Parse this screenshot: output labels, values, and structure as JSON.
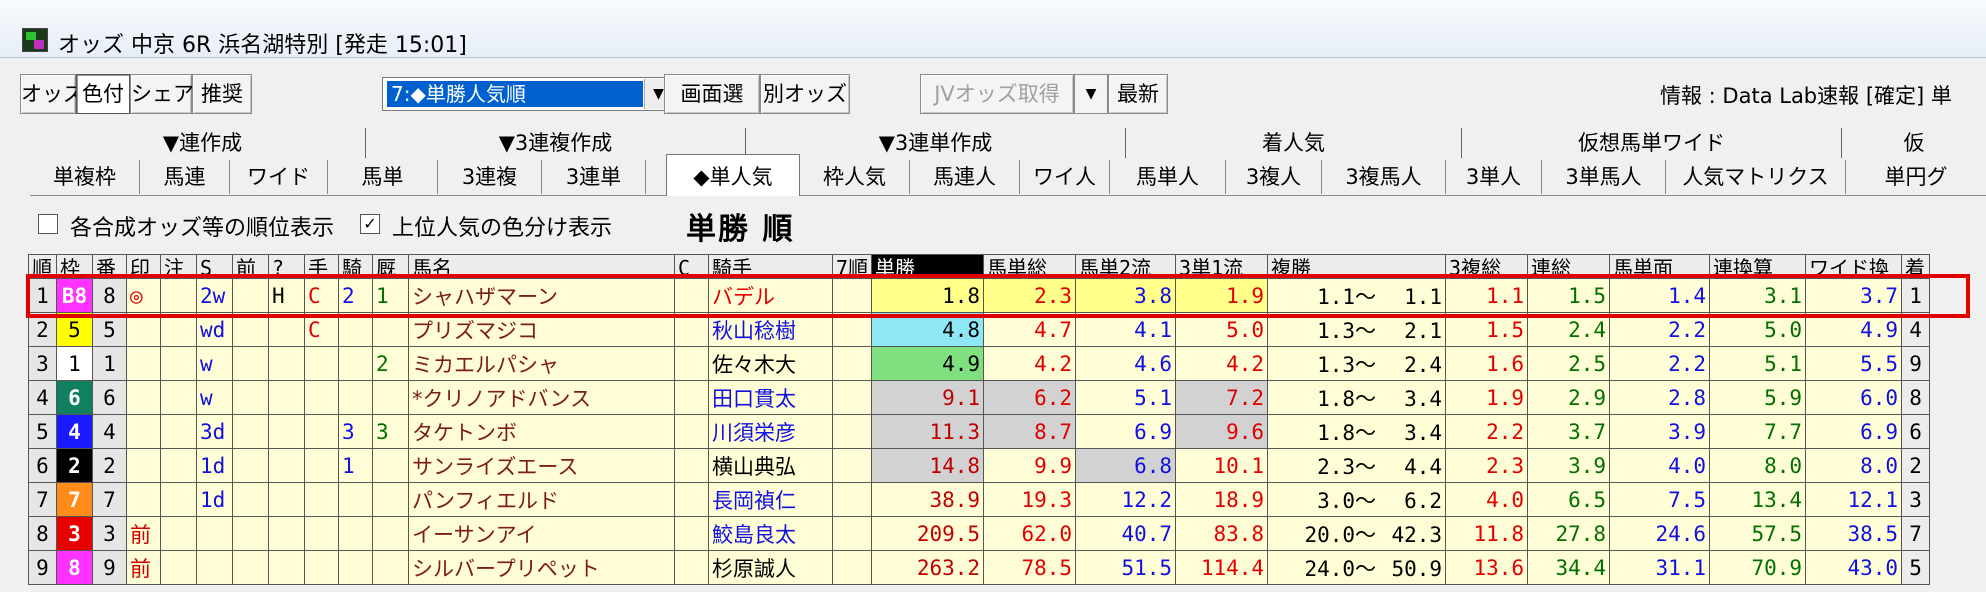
{
  "window": {
    "title": "オッズ 中京 6R 浜名湖特別 [発走 15:01]"
  },
  "toolbar": {
    "btn_odds": "オッズ",
    "btn_color": "色付",
    "btn_share": "シェア",
    "btn_recommend": "推奨",
    "sort_select": "7:◆単勝人気順",
    "btn_screen_select": "画面選",
    "btn_other_odds": "別オッズ",
    "btn_jv_odds": "JVオッズ取得",
    "btn_latest": "最新",
    "info": "情報 : Data Lab速報 [確定] 単"
  },
  "tabs_row1": [
    "▼連作成",
    "▼3連複作成",
    "▼3連単作成",
    "着人気",
    "仮想馬単ワイド",
    "仮"
  ],
  "tabs_row2": [
    "単複枠",
    "馬連",
    "ワイド",
    "馬単",
    "3連複",
    "3連単",
    "◆単人気",
    "枠人気",
    "馬連人",
    "ワイ人",
    "馬単人",
    "3複人",
    "3複馬人",
    "3単人",
    "3単馬人",
    "人気マトリクス",
    "単円グ"
  ],
  "active_tab_index": 6,
  "options": {
    "rank_label": "各合成オッズ等の順位表示",
    "rank_checked": false,
    "color_label": "上位人気の色分け表示",
    "color_checked": true,
    "heading": "単勝 順"
  },
  "columns": [
    "順",
    "枠",
    "番",
    "印",
    "注",
    "S",
    "前",
    "?",
    "手",
    "騎",
    "厩",
    "馬名",
    "C",
    "騎手",
    "7順",
    "単勝",
    "馬単総",
    "馬単2流",
    "3単1流",
    "複勝",
    "3複総",
    "連総",
    "馬単面",
    "連換算",
    "ワイド換",
    "着"
  ],
  "rows": [
    {
      "rank": "1",
      "waku": "8",
      "waku_shown": "B8",
      "ban": "8",
      "mark": "◎",
      "chu": "",
      "s": "2w",
      "mae": "",
      "q": "H",
      "te": "C",
      "ki": "2",
      "kyu": "1",
      "name": "シャハザマーン",
      "c": "",
      "jockey": "バデル",
      "jockey_color": "red",
      "r7": "",
      "tan": "1.8",
      "umatan_all": "2.3",
      "umatan2": "3.8",
      "sanren1": "1.9",
      "fuku_lo": "1.1〜",
      "fuku_hi": "1.1",
      "sanpuku": "1.1",
      "ren": "1.5",
      "umatan_men": "1.4",
      "ren_kan": "3.1",
      "wide_kan": "3.7",
      "chaku": "1"
    },
    {
      "rank": "2",
      "waku": "5",
      "waku_shown": "5",
      "ban": "5",
      "mark": "",
      "chu": "",
      "s": "wd",
      "mae": "",
      "q": "",
      "te": "C",
      "ki": "",
      "kyu": "",
      "name": "プリズマジコ",
      "c": "",
      "jockey": "秋山稔樹",
      "jockey_color": "blue",
      "r7": "",
      "tan": "4.8",
      "umatan_all": "4.7",
      "umatan2": "4.1",
      "sanren1": "5.0",
      "fuku_lo": "1.3〜",
      "fuku_hi": "2.1",
      "sanpuku": "1.5",
      "ren": "2.4",
      "umatan_men": "2.2",
      "ren_kan": "5.0",
      "wide_kan": "4.9",
      "chaku": "4"
    },
    {
      "rank": "3",
      "waku": "1",
      "waku_shown": "1",
      "ban": "1",
      "mark": "",
      "chu": "",
      "s": "w",
      "mae": "",
      "q": "",
      "te": "",
      "ki": "",
      "kyu": "2",
      "name": "ミカエルパシャ",
      "c": "",
      "jockey": "佐々木大",
      "jockey_color": "black",
      "r7": "",
      "tan": "4.9",
      "umatan_all": "4.2",
      "umatan2": "4.6",
      "sanren1": "4.2",
      "fuku_lo": "1.3〜",
      "fuku_hi": "2.4",
      "sanpuku": "1.6",
      "ren": "2.5",
      "umatan_men": "2.2",
      "ren_kan": "5.1",
      "wide_kan": "5.5",
      "chaku": "9"
    },
    {
      "rank": "4",
      "waku": "6",
      "waku_shown": "6",
      "ban": "6",
      "mark": "",
      "chu": "",
      "s": "w",
      "mae": "",
      "q": "",
      "te": "",
      "ki": "",
      "kyu": "",
      "name": "*クリノアドバンス",
      "c": "",
      "jockey": "田口貫太",
      "jockey_color": "blue",
      "r7": "",
      "tan": "9.1",
      "umatan_all": "6.2",
      "umatan2": "5.1",
      "sanren1": "7.2",
      "fuku_lo": "1.8〜",
      "fuku_hi": "3.4",
      "sanpuku": "1.9",
      "ren": "2.9",
      "umatan_men": "2.8",
      "ren_kan": "5.9",
      "wide_kan": "6.0",
      "chaku": "8"
    },
    {
      "rank": "5",
      "waku": "4",
      "waku_shown": "4",
      "ban": "4",
      "mark": "",
      "chu": "",
      "s": "3d",
      "mae": "",
      "q": "",
      "te": "",
      "ki": "3",
      "kyu": "3",
      "name": "タケトンボ",
      "c": "",
      "jockey": "川須栄彦",
      "jockey_color": "blue",
      "r7": "",
      "tan": "11.3",
      "umatan_all": "8.7",
      "umatan2": "6.9",
      "sanren1": "9.6",
      "fuku_lo": "1.8〜",
      "fuku_hi": "3.4",
      "sanpuku": "2.2",
      "ren": "3.7",
      "umatan_men": "3.9",
      "ren_kan": "7.7",
      "wide_kan": "6.9",
      "chaku": "6"
    },
    {
      "rank": "6",
      "waku": "2",
      "waku_shown": "2",
      "ban": "2",
      "mark": "",
      "chu": "",
      "s": "1d",
      "mae": "",
      "q": "",
      "te": "",
      "ki": "1",
      "kyu": "",
      "name": "サンライズエース",
      "c": "",
      "jockey": "横山典弘",
      "jockey_color": "black",
      "r7": "",
      "tan": "14.8",
      "umatan_all": "9.9",
      "umatan2": "6.8",
      "sanren1": "10.1",
      "fuku_lo": "2.3〜",
      "fuku_hi": "4.4",
      "sanpuku": "2.3",
      "ren": "3.9",
      "umatan_men": "4.0",
      "ren_kan": "8.0",
      "wide_kan": "8.0",
      "chaku": "2"
    },
    {
      "rank": "7",
      "waku": "7",
      "waku_shown": "7",
      "ban": "7",
      "mark": "",
      "chu": "",
      "s": "1d",
      "mae": "",
      "q": "",
      "te": "",
      "ki": "",
      "kyu": "",
      "name": "パンフィエルド",
      "c": "",
      "jockey": "長岡禎仁",
      "jockey_color": "blue",
      "r7": "",
      "tan": "38.9",
      "umatan_all": "19.3",
      "umatan2": "12.2",
      "sanren1": "18.9",
      "fuku_lo": "3.0〜",
      "fuku_hi": "6.2",
      "sanpuku": "4.0",
      "ren": "6.5",
      "umatan_men": "7.5",
      "ren_kan": "13.4",
      "wide_kan": "12.1",
      "chaku": "3"
    },
    {
      "rank": "8",
      "waku": "3",
      "waku_shown": "3",
      "ban": "3",
      "mark": "前",
      "chu": "",
      "s": "",
      "mae": "",
      "q": "",
      "te": "",
      "ki": "",
      "kyu": "",
      "name": "イーサンアイ",
      "c": "",
      "jockey": "鮫島良太",
      "jockey_color": "blue",
      "r7": "",
      "tan": "209.5",
      "umatan_all": "62.0",
      "umatan2": "40.7",
      "sanren1": "83.8",
      "fuku_lo": "20.0〜",
      "fuku_hi": "42.3",
      "sanpuku": "11.8",
      "ren": "27.8",
      "umatan_men": "24.6",
      "ren_kan": "57.5",
      "wide_kan": "38.5",
      "chaku": "7"
    },
    {
      "rank": "9",
      "waku": "8",
      "waku_shown": "8",
      "ban": "9",
      "mark": "前",
      "chu": "",
      "s": "",
      "mae": "",
      "q": "",
      "te": "",
      "ki": "",
      "kyu": "",
      "name": "シルバープリペット",
      "c": "",
      "jockey": "杉原誠人",
      "jockey_color": "black",
      "r7": "",
      "tan": "263.2",
      "umatan_all": "78.5",
      "umatan2": "51.5",
      "sanren1": "114.4",
      "fuku_lo": "24.0〜",
      "fuku_hi": "50.9",
      "sanpuku": "13.6",
      "ren": "34.4",
      "umatan_men": "31.1",
      "ren_kan": "70.9",
      "wide_kan": "43.0",
      "chaku": "5"
    }
  ],
  "colors": {
    "waku": {
      "1": "#ffffff",
      "2": "#000000",
      "3": "#e60000",
      "4": "#1a1aff",
      "5": "#ffff00",
      "6": "#108060",
      "7": "#ff8c1a",
      "8": "#ff33ff"
    },
    "highlight": "#e00000"
  }
}
